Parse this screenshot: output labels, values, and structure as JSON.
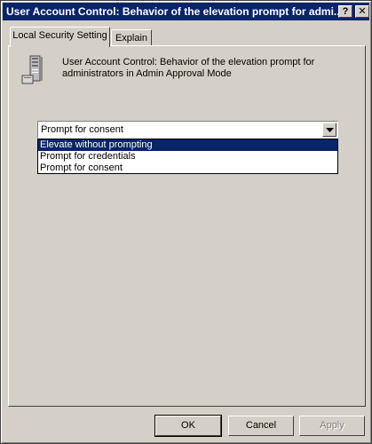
{
  "window": {
    "title": "User Account Control: Behavior of the elevation prompt for admi...",
    "help_button": "?",
    "close_button": "✕"
  },
  "tabs": [
    {
      "label": "Local Security Setting",
      "active": true
    },
    {
      "label": "Explain",
      "active": false
    }
  ],
  "policy": {
    "icon": "server-computer-icon",
    "description": "User Account Control: Behavior of the elevation prompt for administrators in Admin Approval Mode"
  },
  "combo": {
    "selected_value": "Prompt for consent",
    "options": [
      {
        "label": "Elevate without prompting",
        "highlighted": true
      },
      {
        "label": "Prompt for credentials",
        "highlighted": false
      },
      {
        "label": "Prompt for consent",
        "highlighted": false
      }
    ]
  },
  "buttons": {
    "ok": "OK",
    "cancel": "Cancel",
    "apply": "Apply"
  },
  "colors": {
    "titlebar": "#0a246a",
    "face": "#d4d0c8",
    "selection": "#0a246a"
  }
}
